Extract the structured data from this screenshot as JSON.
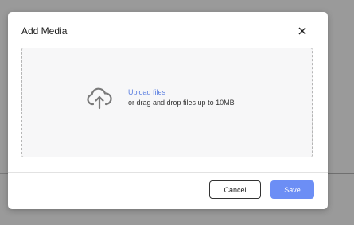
{
  "modal": {
    "title": "Add Media",
    "close_icon": "close-icon"
  },
  "dropzone": {
    "icon": "cloud-upload-icon",
    "upload_link": "Upload files",
    "hint": "or drag and drop files up to 10MB"
  },
  "footer": {
    "cancel_label": "Cancel",
    "save_label": "Save"
  },
  "colors": {
    "accent": "#6c8ef5",
    "link": "#5b7fe0",
    "backdrop": "#9a9a9a"
  }
}
